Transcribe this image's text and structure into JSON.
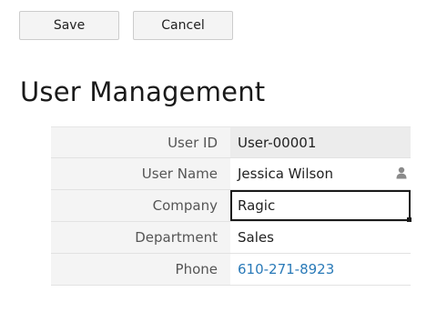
{
  "toolbar": {
    "save_label": "Save",
    "cancel_label": "Cancel"
  },
  "page": {
    "title": "User Management"
  },
  "form": {
    "fields": [
      {
        "label": "User ID",
        "value": "User-00001",
        "readonly": true
      },
      {
        "label": "User Name",
        "value": "Jessica Wilson",
        "icon": "user-icon"
      },
      {
        "label": "Company",
        "value": "Ragic",
        "active": true
      },
      {
        "label": "Department",
        "value": "Sales"
      },
      {
        "label": "Phone",
        "value": "610-271-8923",
        "link_color": "#2a7ab8"
      }
    ]
  }
}
